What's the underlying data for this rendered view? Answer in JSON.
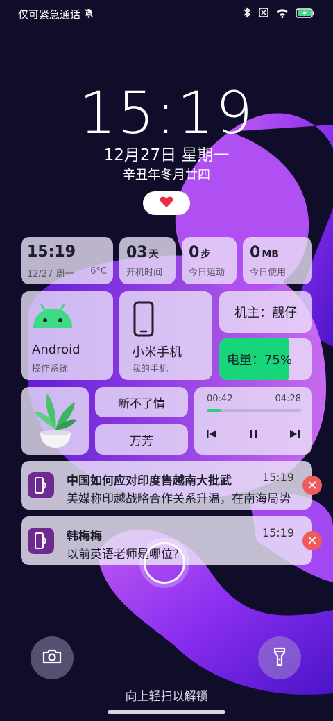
{
  "status_bar": {
    "left_text": "仅可紧急通话",
    "battery_color": "#3ddc84"
  },
  "lock": {
    "time": "15:19",
    "date": "12月27日 星期一",
    "lunar": "辛丑年冬月廿四"
  },
  "widgets": {
    "clock": {
      "time": "15:19",
      "date": "12/27 周一",
      "temp": "6°C"
    },
    "uptime": {
      "value": "03",
      "unit": "天",
      "label": "开机时间"
    },
    "steps": {
      "value": "0",
      "unit": "步",
      "label": "今日运动"
    },
    "data_usage": {
      "value": "0",
      "unit": "MB",
      "label": "今日使用"
    },
    "os": {
      "name": "Android",
      "label": "操作系统"
    },
    "device": {
      "name": "小米手机",
      "label": "我的手机"
    },
    "owner": {
      "text": "机主：靓仔"
    },
    "battery": {
      "text": "电量：75%",
      "level": 0.75,
      "color": "#17d67a"
    },
    "chips": {
      "top": "新不了情",
      "bottom": "万芳"
    },
    "music": {
      "elapsed": "00:42",
      "total": "04:28",
      "progress": 0.157
    }
  },
  "notifications": [
    {
      "title": "中国如何应对印度售越南大批武",
      "time": "15:19",
      "body": "美媒称印越战略合作关系升温，在南海局势"
    },
    {
      "title": "韩梅梅",
      "time": "15:19",
      "body": "以前英语老师是哪位?"
    }
  ],
  "bottom": {
    "hint": "向上轻扫以解锁"
  },
  "colors": {
    "accent_red": "#f05a5a",
    "notif_icon": "#6e2a91"
  }
}
